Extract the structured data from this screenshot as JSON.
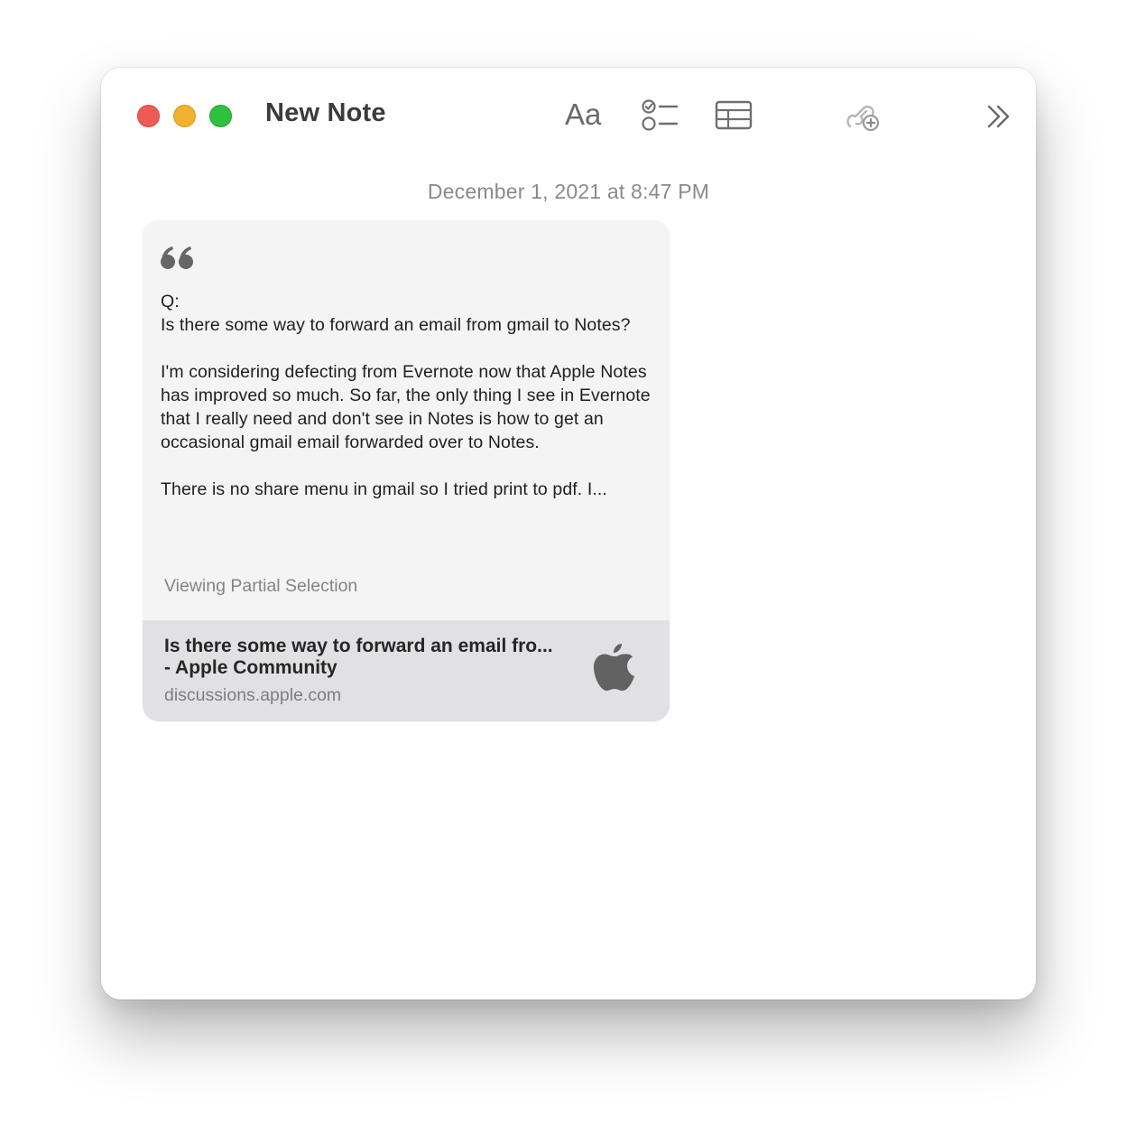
{
  "window": {
    "title": "New Note"
  },
  "toolbar": {
    "format_label": "Aa",
    "format_icon": "text-format-icon",
    "checklist_icon": "checklist-icon",
    "table_icon": "table-icon",
    "collaborate_icon": "collaborate-icon",
    "more_icon": "chevron-double-right-icon"
  },
  "note": {
    "date": "December 1, 2021 at 8:47 PM",
    "quote_card": {
      "quote_icon": "quote-icon",
      "paragraphs": [
        "Q:\nIs there some way to forward an email from gmail to Notes?",
        "I'm considering defecting from Evernote now that Apple Notes has improved so much. So far, the only thing I see in Evernote that I really need and don't see in Notes is how to get an occasional gmail email forwarded over to Notes.",
        "There is no share menu in gmail so I tried print to pdf. I..."
      ],
      "partial_label": "Viewing Partial Selection",
      "link": {
        "title": "Is there some way to forward an email fro... - Apple Community",
        "domain": "discussions.apple.com",
        "icon": "apple-logo-icon"
      }
    }
  },
  "colors": {
    "close": "#ee5a54",
    "minimize": "#f4b12e",
    "zoom": "#2fc03f",
    "card_bg": "#f4f4f5",
    "link_bg": "#e1e1e4"
  }
}
